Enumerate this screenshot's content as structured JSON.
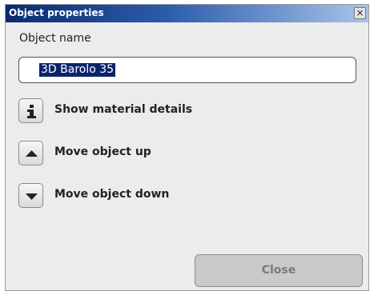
{
  "window": {
    "title": "Object properties",
    "close_glyph": "×"
  },
  "object_name": {
    "label": "Object name",
    "value": "3D Barolo 35"
  },
  "actions": [
    {
      "label": "Show material details",
      "icon": "info-icon"
    },
    {
      "label": "Move object up",
      "icon": "arrow-up-icon"
    },
    {
      "label": "Move object down",
      "icon": "arrow-down-icon"
    }
  ],
  "footer": {
    "close_label": "Close"
  },
  "colors": {
    "titlebar_start": "#0a2a6e",
    "titlebar_end": "#a8c4ea",
    "selection": "#0a246a",
    "dialog_bg": "#ececec",
    "disabled_text": "#7a7a7a"
  }
}
